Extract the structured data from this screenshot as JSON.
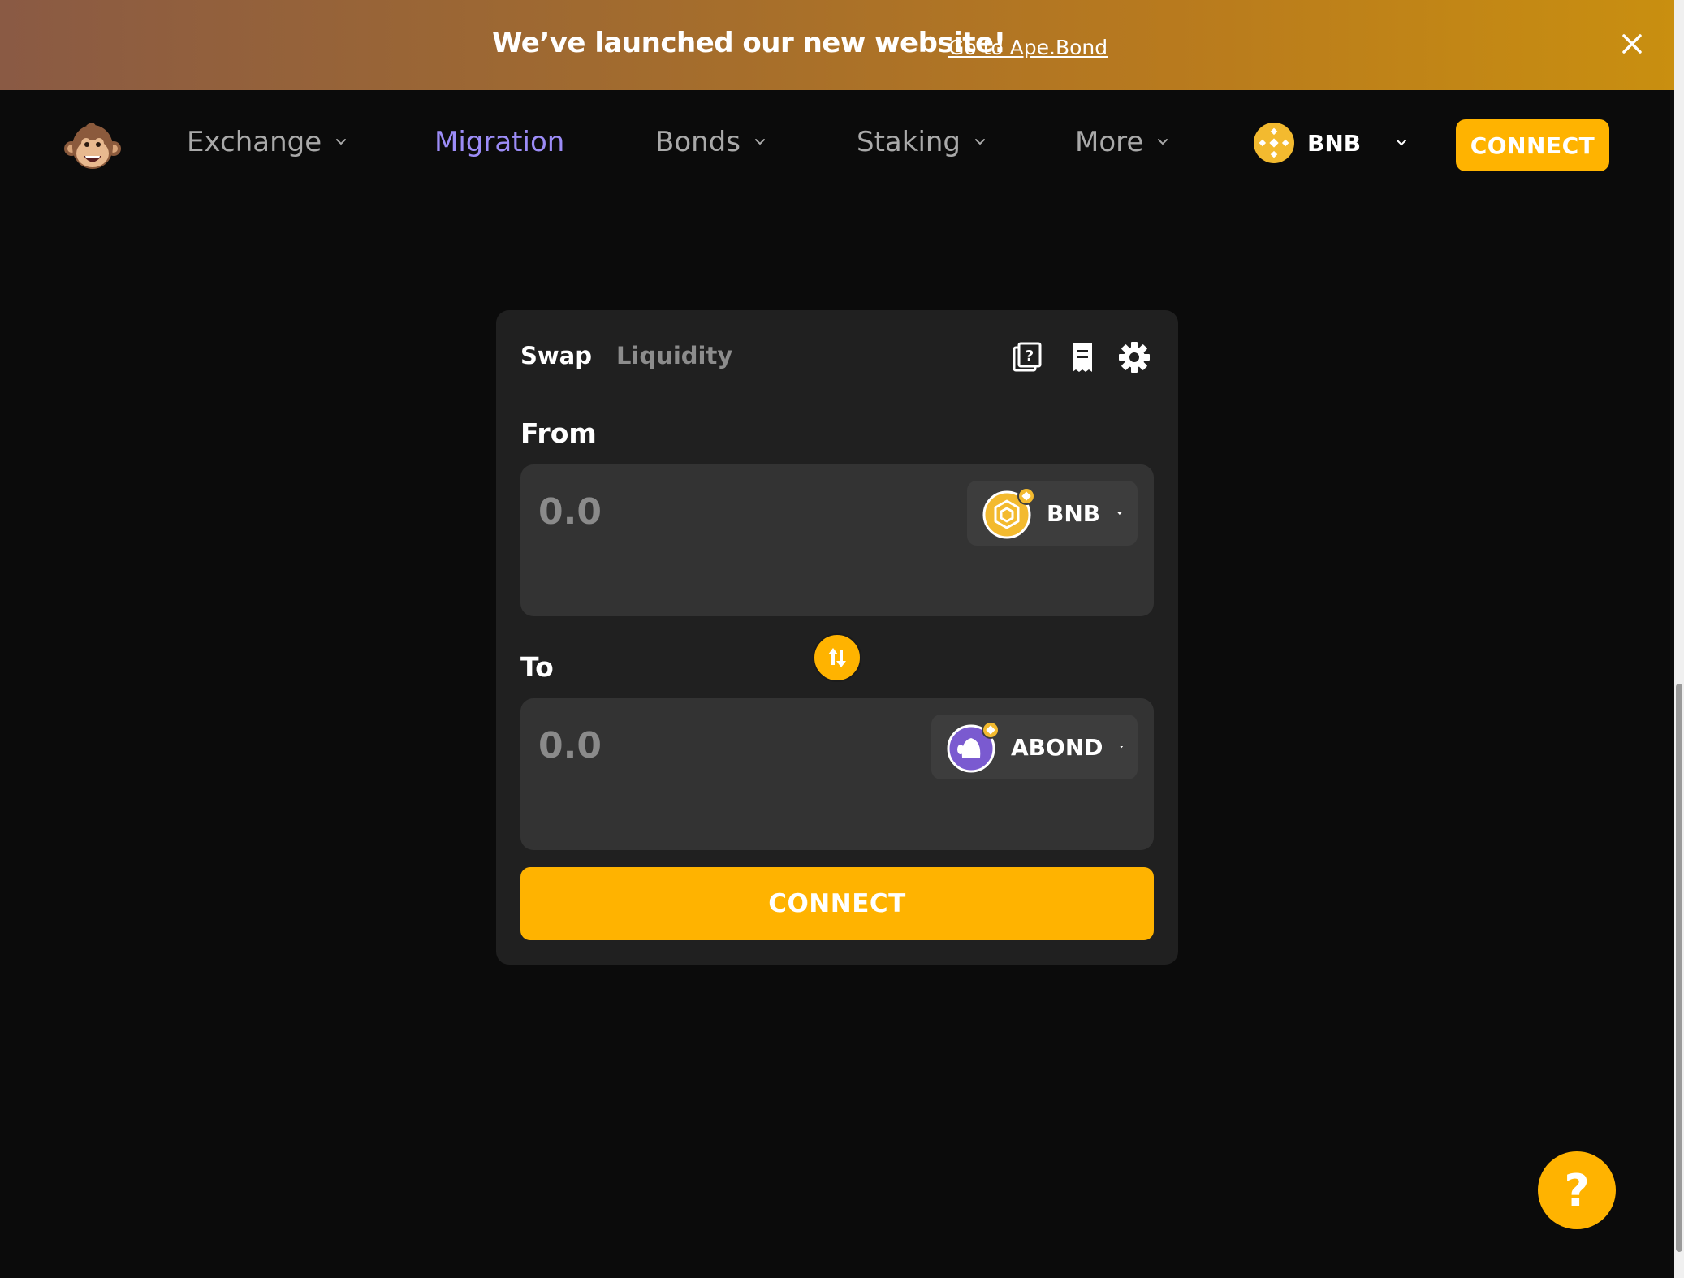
{
  "banner": {
    "message": "We’ve launched our new website!",
    "link_text": "Go to Ape.Bond",
    "close_icon": "close-icon"
  },
  "navbar": {
    "logo_icon": "monkey-logo-icon",
    "items": [
      {
        "label": "Exchange",
        "has_dropdown": true
      },
      {
        "label": "Migration",
        "has_dropdown": false,
        "active": true
      },
      {
        "label": "Bonds",
        "has_dropdown": true
      },
      {
        "label": "Staking",
        "has_dropdown": true
      },
      {
        "label": "More",
        "has_dropdown": true
      }
    ],
    "network": {
      "label": "BNB",
      "icon": "bnb-icon"
    },
    "connect_label": "CONNECT"
  },
  "swap_card": {
    "tabs": [
      {
        "label": "Swap",
        "active": true
      },
      {
        "label": "Liquidity",
        "active": false
      }
    ],
    "header_icons": [
      "help-book-icon",
      "receipt-icon",
      "gear-icon"
    ],
    "from": {
      "label": "From",
      "amount_placeholder": "0.0",
      "token": "BNB",
      "token_icon": "bnb-token-icon"
    },
    "to": {
      "label": "To",
      "amount_placeholder": "0.0",
      "token": "ABOND",
      "token_icon": "abond-token-icon"
    },
    "swap_direction_icon": "swap-arrows-icon",
    "connect_label": "CONNECT"
  },
  "help_button": {
    "label": "?"
  },
  "colors": {
    "accent": "#ffb300",
    "active_nav": "#9c8cf7",
    "background": "#0b0b0b",
    "card": "#202020",
    "panel": "#333333"
  }
}
